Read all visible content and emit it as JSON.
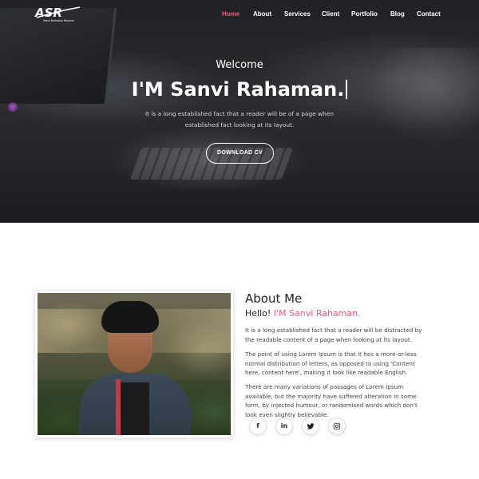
{
  "brand": {
    "logo_text": "ASR",
    "logo_tagline": "Sanvi Rahaman Resume"
  },
  "nav": {
    "items": [
      {
        "label": "Home",
        "active": true
      },
      {
        "label": "About",
        "active": false
      },
      {
        "label": "Services",
        "active": false
      },
      {
        "label": "Client",
        "active": false
      },
      {
        "label": "Portfolio",
        "active": false
      },
      {
        "label": "Blog",
        "active": false
      },
      {
        "label": "Contact",
        "active": false
      }
    ]
  },
  "hero": {
    "welcome": "Welcome",
    "title": "I'M Sanvi Rahaman.",
    "text": "It is a long established fact that a reader will be of a page when established fact looking at its layout.",
    "button": "DOWNLOAD CV"
  },
  "about": {
    "title": "About Me",
    "hello": "Hello!",
    "name": "I'M Sanvi Rahaman.",
    "p1": "It is a long established fact that a reader will be distracted by the readable content of a page when looking at its layout.",
    "p2": "The point of using Lorem Ipsum is that it has a more-or-less normal distribution of letters, as opposed to using 'Content here, content here', making it look like readable English.",
    "p3": "There are many variations of passages of Lorem Ipsum available, but the majority have suffered alteration in some form, by injected humour, or randomised words which don't look even slightly believable.",
    "social": [
      {
        "icon": "facebook-icon",
        "glyph": "f"
      },
      {
        "icon": "linkedin-icon",
        "glyph": "in"
      },
      {
        "icon": "twitter-icon",
        "glyph": ""
      },
      {
        "icon": "instagram-icon",
        "glyph": ""
      }
    ]
  },
  "colors": {
    "accent": "#ef5b78",
    "hero_dark": "#222326",
    "text": "#444444"
  }
}
